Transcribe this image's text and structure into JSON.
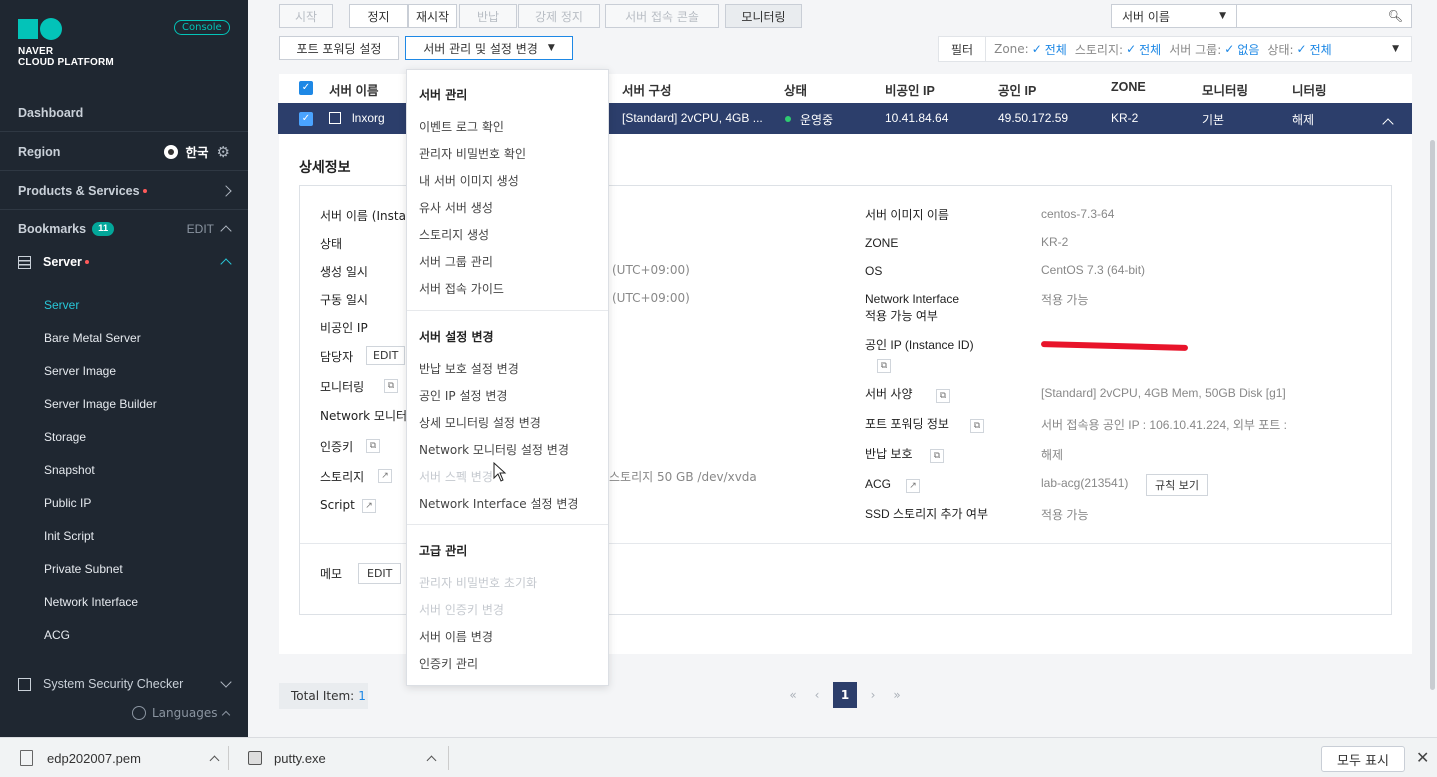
{
  "sidebar": {
    "logo_line1": "NAVER",
    "logo_line2": "CLOUD PLATFORM",
    "console": "Console",
    "dashboard": "Dashboard",
    "region": "Region",
    "region_value": "한국",
    "products": "Products & Services",
    "bookmarks": "Bookmarks",
    "bookmarks_count": "11",
    "bookmarks_edit": "EDIT",
    "server_group": "Server",
    "items": [
      "Server",
      "Bare Metal Server",
      "Server Image",
      "Server Image Builder",
      "Storage",
      "Snapshot",
      "Public IP",
      "Init Script",
      "Private Subnet",
      "Network Interface",
      "ACG"
    ],
    "next_group": "System Security Checker",
    "languages": "Languages"
  },
  "toolbar": {
    "row1": [
      "시작",
      "정지",
      "재시작",
      "반납",
      "강제 정지",
      "서버 접속 콘솔",
      "모니터링"
    ],
    "port_forward": "포트 포워딩 설정",
    "manage": "서버 관리 및 설정 변경",
    "search_select": "서버 이름",
    "filter": "필터",
    "filters": [
      {
        "label": "Zone:",
        "value": "전체"
      },
      {
        "label": "스토리지:",
        "value": "전체"
      },
      {
        "label": "서버 그룹:",
        "value": "없음"
      },
      {
        "label": "상태:",
        "value": "전체"
      }
    ]
  },
  "table": {
    "headers": [
      "서버 이름",
      "서버 구성",
      "상태",
      "비공인 IP",
      "공인 IP",
      "ZONE",
      "모니터링",
      "니터링"
    ],
    "row": {
      "name": "lnxorg",
      "spec": "[Standard] 2vCPU, 4GB ...",
      "status": "운영중",
      "private_ip": "10.41.84.64",
      "public_ip": "49.50.172.59",
      "zone": "KR-2",
      "monitoring": "기본",
      "detail_monitoring": "해제"
    }
  },
  "detail": {
    "title": "상세정보",
    "left_labels": [
      "서버 이름 (Insta",
      "상태",
      "생성 일시",
      "구동 일시",
      "비공인 IP",
      "담당자",
      "모니터링",
      "Network 모니터",
      "인증키",
      "스토리지",
      "Script"
    ],
    "edit": "EDIT",
    "created_tz": "(UTC+09:00)",
    "started_tz": "(UTC+09:00)",
    "storage_value": "스토리지  50 GB /dev/xvda",
    "right_labels": [
      "서버 이미지 이름",
      "ZONE",
      "OS",
      "Network Interface\n적용 가능 여부",
      "공인 IP (Instance ID)",
      "서버 사양",
      "포트 포워딩 정보",
      "반납 보호",
      "ACG",
      "SSD 스토리지 추가 여부"
    ],
    "right_values": [
      "centos-7.3-64",
      "KR-2",
      "CentOS 7.3 (64-bit)",
      "적용 가능",
      "",
      "[Standard] 2vCPU, 4GB Mem, 50GB Disk [g1]",
      "서버 접속용 공인 IP : 106.10.41.224, 외부 포트 :",
      "해제",
      "lab-acg(213541)",
      "적용 가능"
    ],
    "acg_rules": "규칙 보기",
    "memo": "메모",
    "memo_edit": "EDIT"
  },
  "dropdown": {
    "section1": "서버 관리",
    "items1": [
      "이벤트 로그 확인",
      "관리자 비밀번호 확인",
      "내 서버 이미지 생성",
      "유사 서버 생성",
      "스토리지 생성",
      "서버 그룹 관리",
      "서버 접속 가이드"
    ],
    "section2": "서버 설정 변경",
    "items2": [
      "반납 보호 설정 변경",
      "공인 IP 설정 변경",
      "상세 모니터링 설정 변경",
      "Network 모니터링 설정 변경",
      "서버 스펙 변경",
      "Network Interface 설정 변경"
    ],
    "section3": "고급 관리",
    "items3": [
      "관리자 비밀번호 초기화",
      "서버 인증키 변경",
      "서버 이름 변경",
      "인증키 관리"
    ]
  },
  "footer": {
    "total_label": "Total Item:",
    "total_value": "1",
    "page": "1"
  },
  "downloads": {
    "file1": "edp202007.pem",
    "file2": "putty.exe",
    "show_all": "모두 표시"
  },
  "colors": {
    "sidebar_bg": "#1f2731",
    "accent": "#03c3b8",
    "selected_row": "#2c3e6b",
    "status_green": "#2ecc71",
    "link_blue": "#1e88e5"
  }
}
